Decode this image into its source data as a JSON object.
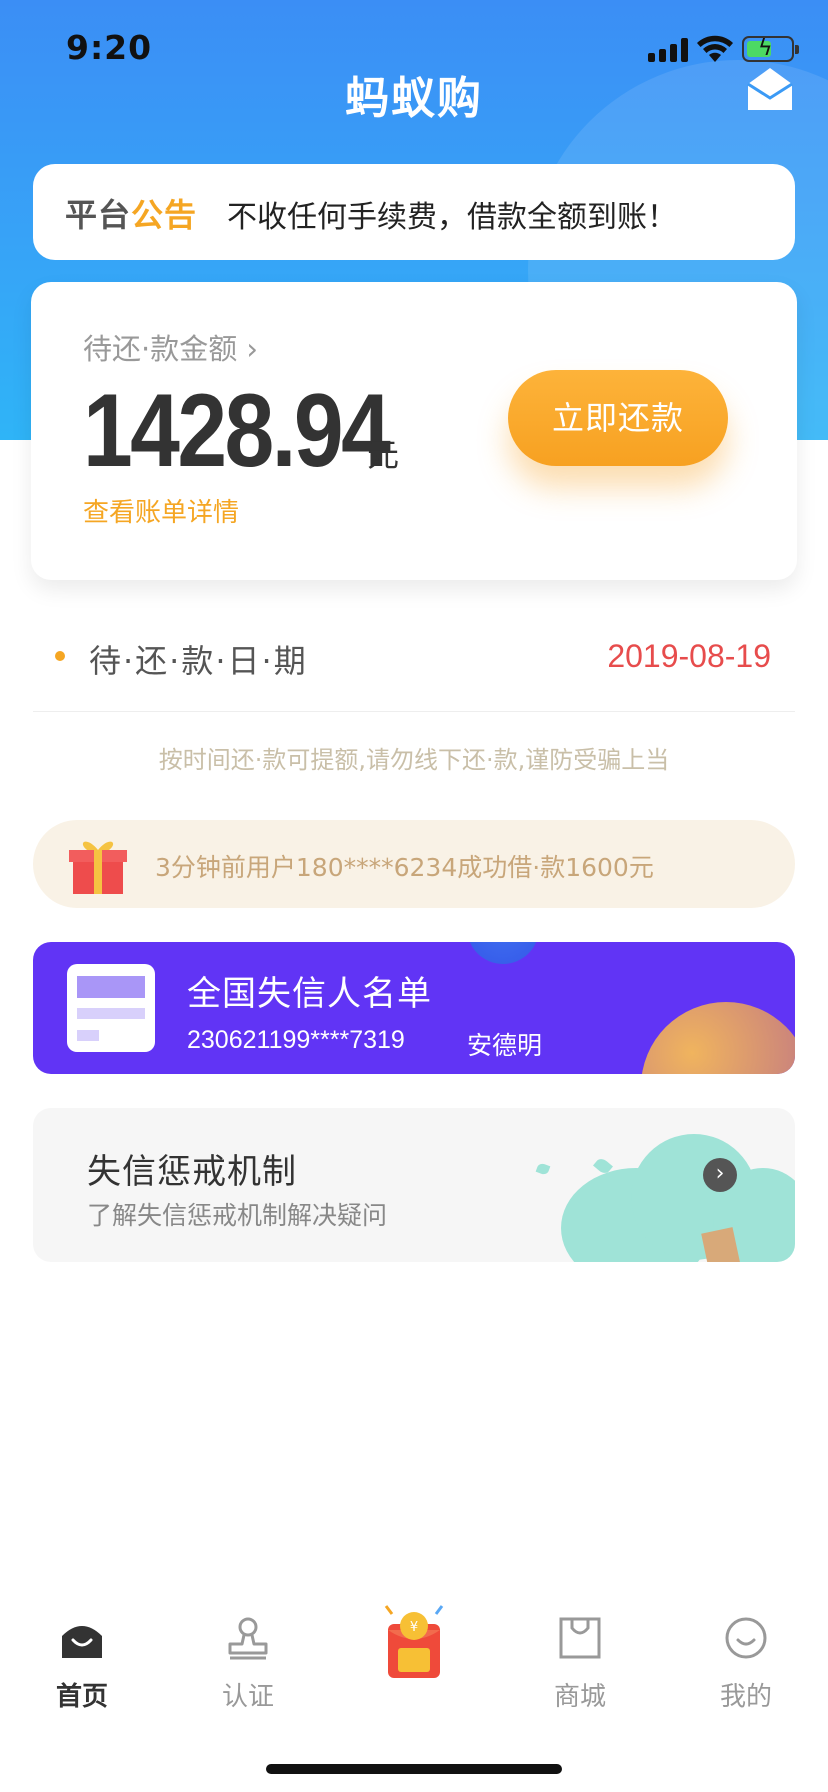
{
  "status_bar": {
    "time": "9:20"
  },
  "header": {
    "title": "蚂蚁购",
    "mail_icon": "envelope-open-icon"
  },
  "notice": {
    "label_part1": "平台",
    "label_part2": "公告",
    "text": "不收任何手续费，借款全额到账！"
  },
  "amount_card": {
    "label": "待还·款金额 ›",
    "amount": "1428.94",
    "unit": "元",
    "bill_link": "查看账单详情",
    "repay_button": "立即还款",
    "colors": {
      "accent": "#f7a121"
    }
  },
  "due": {
    "label": "待·还·款·日·期",
    "date": "2019-08-19",
    "date_color": "#e74c4c"
  },
  "warning": "按时间还·款可提额,请勿线下还·款,谨防受骗上当",
  "promo": {
    "icon": "gift-icon",
    "text": "3分钟前用户180****6234成功借·款1600元"
  },
  "blacklist": {
    "title": "全国失信人名单",
    "id_number": "230621199****7319",
    "name": "安德明",
    "bg_color": "#6134f5"
  },
  "mechanism": {
    "title": "失信惩戒机制",
    "subtitle": "了解失信惩戒机制解决疑问"
  },
  "tabbar": {
    "items": [
      {
        "label": "首页",
        "icon": "home-icon",
        "active": true
      },
      {
        "label": "认证",
        "icon": "stamp-icon",
        "active": false
      },
      {
        "label": "",
        "icon": "red-packet-icon",
        "active": false
      },
      {
        "label": "商城",
        "icon": "shopping-bag-icon",
        "active": false
      },
      {
        "label": "我的",
        "icon": "smiley-icon",
        "active": false
      }
    ]
  }
}
